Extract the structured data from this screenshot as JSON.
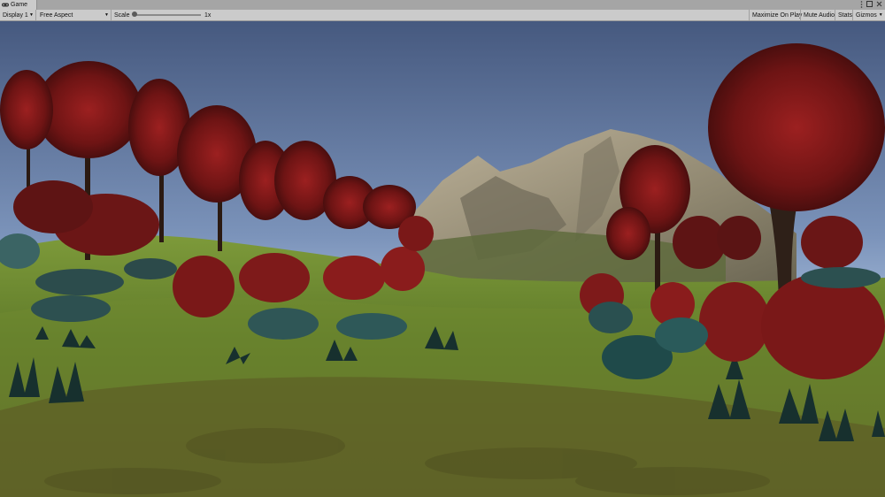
{
  "window": {
    "tab_label": "Game"
  },
  "toolbar": {
    "display": "Display 1",
    "aspect": "Free Aspect",
    "scale_label": "Scale",
    "scale_value": "1x",
    "maximize_on_play": "Maximize On Play",
    "mute_audio": "Mute Audio",
    "stats": "Stats",
    "gizmos": "Gizmos"
  },
  "icons": {
    "tab": "gamepad-icon",
    "menu": "kebab-menu-icon",
    "maximize": "maximize-icon",
    "close": "close-icon",
    "dropdown": "chevron-down-icon"
  },
  "colors": {
    "sky_top": "#4a5d86",
    "sky_bottom": "#8da5c8",
    "grass": "#5d7a2a",
    "foliage": "#8b1a1a",
    "mountain": "#a89f8a"
  }
}
